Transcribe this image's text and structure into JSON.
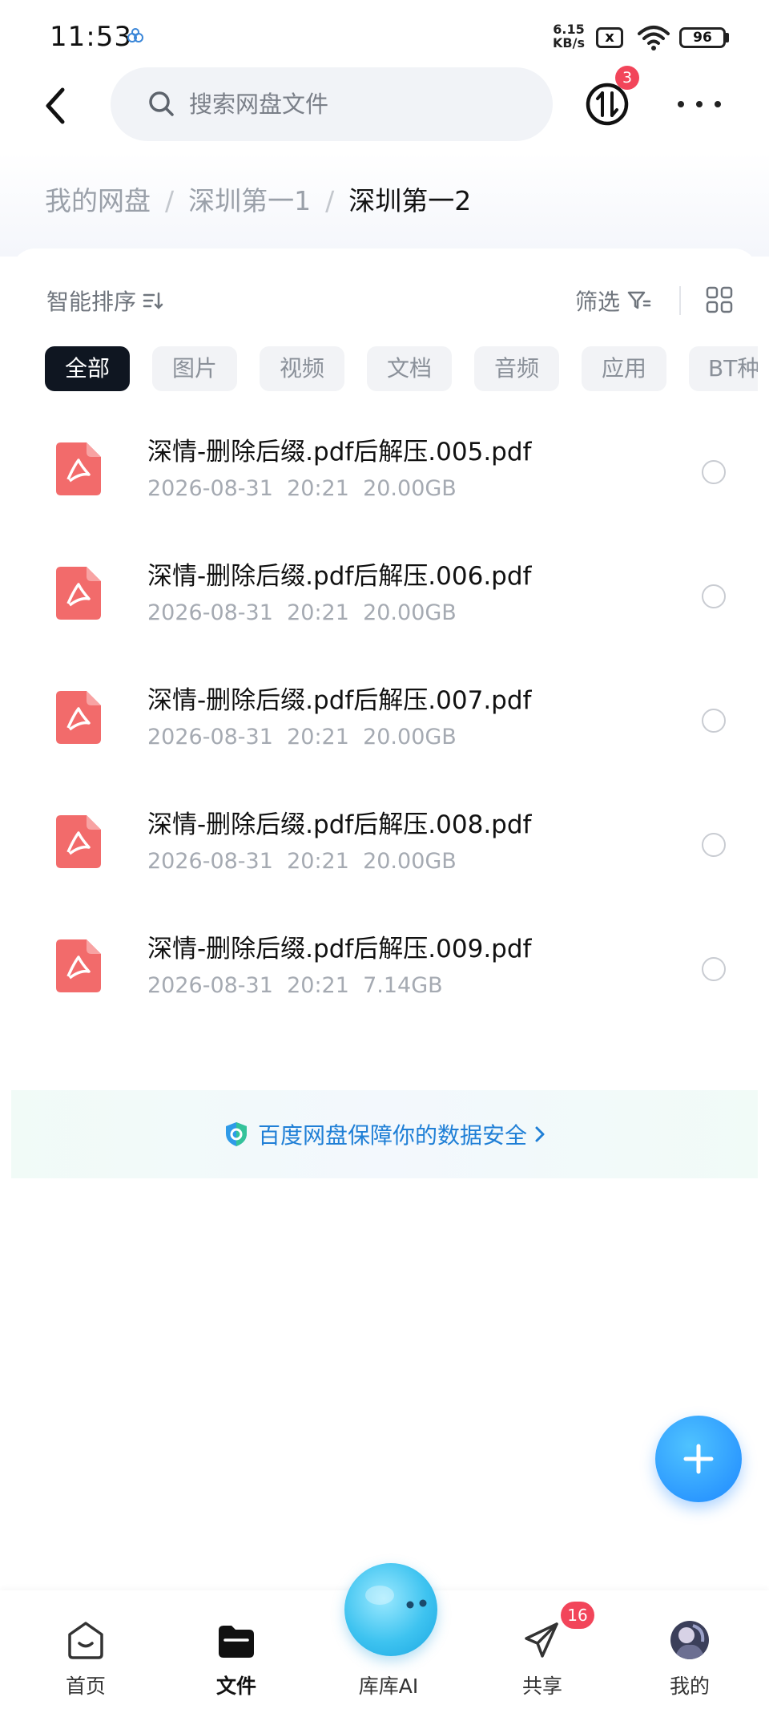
{
  "status_bar": {
    "time": "11:53",
    "net_speed_value": "6.15",
    "net_speed_unit": "KB/s",
    "sim_label": "x",
    "battery": "96"
  },
  "header": {
    "search_placeholder": "搜索网盘文件",
    "transfer_badge": "3"
  },
  "breadcrumb": {
    "items": [
      "我的网盘",
      "深圳第一1"
    ],
    "current": "深圳第一2",
    "separator": "/"
  },
  "toolbar": {
    "sort_label": "智能排序",
    "filter_label": "筛选"
  },
  "categories": [
    "全部",
    "图片",
    "视频",
    "文档",
    "音频",
    "应用",
    "BT种"
  ],
  "active_category": "全部",
  "files": [
    {
      "name": "深情-删除后缀.pdf后解压.005.pdf",
      "date": "2026-08-31",
      "time": "20:21",
      "size": "20.00GB"
    },
    {
      "name": "深情-删除后缀.pdf后解压.006.pdf",
      "date": "2026-08-31",
      "time": "20:21",
      "size": "20.00GB"
    },
    {
      "name": "深情-删除后缀.pdf后解压.007.pdf",
      "date": "2026-08-31",
      "time": "20:21",
      "size": "20.00GB"
    },
    {
      "name": "深情-删除后缀.pdf后解压.008.pdf",
      "date": "2026-08-31",
      "time": "20:21",
      "size": "20.00GB"
    },
    {
      "name": "深情-删除后缀.pdf后解压.009.pdf",
      "date": "2026-08-31",
      "time": "20:21",
      "size": "7.14GB"
    }
  ],
  "security_banner": {
    "text": "百度网盘保障你的数据安全"
  },
  "bottom_nav": {
    "items": [
      {
        "label": "首页",
        "icon": "home-icon"
      },
      {
        "label": "文件",
        "icon": "folder-icon"
      },
      {
        "label": "库库AI",
        "icon": "ai-assistant-icon"
      },
      {
        "label": "共享",
        "icon": "share-icon"
      },
      {
        "label": "我的",
        "icon": "avatar-icon"
      }
    ],
    "active": "文件",
    "share_badge": "16"
  },
  "colors": {
    "accent": "#1e88ff",
    "badge": "#f2455a",
    "pdf": "#f26b6b",
    "chip_active_bg": "#0f1621"
  }
}
